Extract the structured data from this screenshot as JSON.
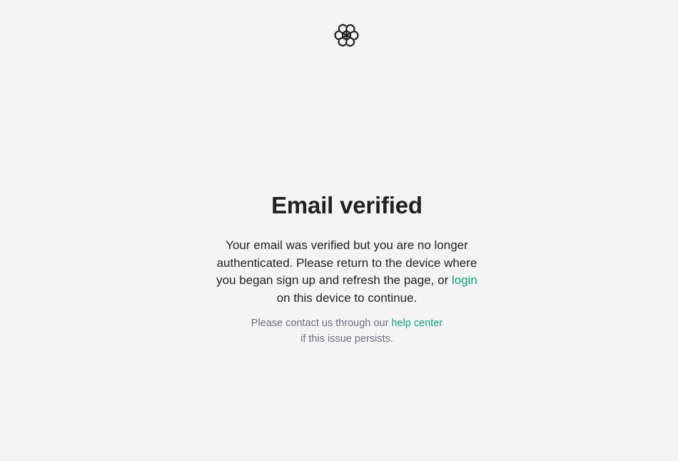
{
  "brand": {
    "logo_icon": "openai-logo-icon",
    "accent_color": "#10a37f"
  },
  "heading": "Email verified",
  "message": {
    "before_link": "Your email was verified but you are no longer authenticated. Please return to the device where you began sign up and refresh the page, or ",
    "link_text": "login",
    "after_link": " on this device to continue."
  },
  "help": {
    "before_link": "Please contact us through our ",
    "link_text": "help center",
    "after_link": "if this issue persists."
  }
}
